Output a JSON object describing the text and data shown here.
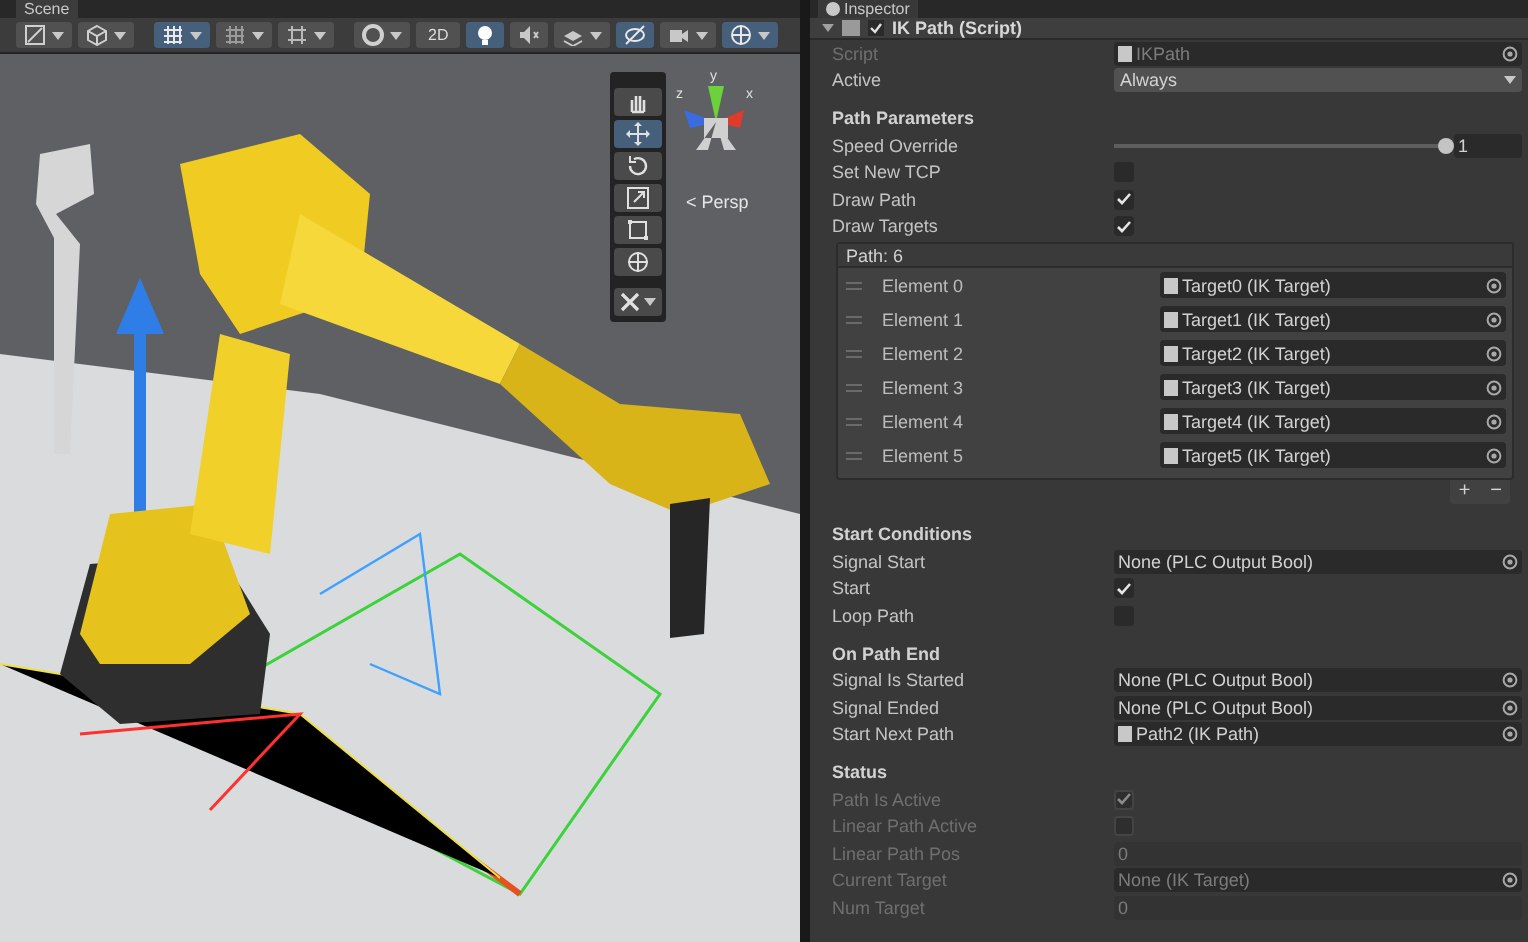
{
  "scene": {
    "tab": "Scene",
    "toolbar": [
      [
        {
          "selected": false,
          "dropdown": true
        },
        {
          "selected": false,
          "dropdown": true
        }
      ],
      [
        {
          "selected": true,
          "dropdown": true
        },
        {
          "selected": false,
          "dropdown": true
        },
        {
          "selected": false,
          "dropdown": true
        }
      ],
      [
        {
          "selected": false,
          "dropdown": true
        },
        {
          "selected": false,
          "dropdown": false,
          "label": "2D"
        },
        {
          "selected": true,
          "dropdown": false
        },
        {
          "selected": false,
          "dropdown": false
        },
        {
          "selected": false,
          "dropdown": true
        },
        {
          "selected": true,
          "dropdown": false
        },
        {
          "selected": false,
          "dropdown": true
        },
        {
          "selected": true,
          "dropdown": true
        }
      ]
    ],
    "tools": [
      {
        "selected": false
      },
      {
        "selected": true
      },
      {
        "selected": false
      },
      {
        "selected": false
      },
      {
        "selected": false
      },
      {
        "selected": false
      }
    ],
    "axes": [
      "y",
      "x",
      "z"
    ],
    "view_label": "< Persp"
  },
  "inspector": {
    "tab": "Inspector",
    "component": {
      "title": "IK Path (Script)",
      "enabled": true
    },
    "groups": [
      {
        "fields": [
          {
            "kind": "object",
            "label": "Script",
            "value": "IKPath",
            "icon": true,
            "disabled": true
          },
          {
            "kind": "dropdown",
            "label": "Active",
            "value": "Always",
            "disabled": false
          }
        ]
      },
      {
        "title": "Path Parameters",
        "fields": [
          {
            "kind": "slider",
            "label": "Speed Override",
            "level": 1,
            "value": "1",
            "disabled": false
          },
          {
            "kind": "checkbox",
            "label": "Set New TCP",
            "checked": false,
            "disabled": false
          },
          {
            "kind": "checkbox",
            "label": "Draw Path",
            "checked": true,
            "disabled": false
          },
          {
            "kind": "checkbox",
            "label": "Draw Targets",
            "checked": true,
            "disabled": false
          }
        ],
        "list": {
          "header": "Path: 6",
          "add": "+",
          "remove": "−",
          "elements": [
            {
              "label": "Element 0",
              "value": "Target0 (IK Target)"
            },
            {
              "label": "Element 1",
              "value": "Target1 (IK Target)"
            },
            {
              "label": "Element 2",
              "value": "Target2 (IK Target)"
            },
            {
              "label": "Element 3",
              "value": "Target3 (IK Target)"
            },
            {
              "label": "Element 4",
              "value": "Target4 (IK Target)"
            },
            {
              "label": "Element 5",
              "value": "Target5 (IK Target)"
            }
          ]
        }
      },
      {
        "title": "Start Conditions",
        "fields": [
          {
            "kind": "object",
            "label": "Signal Start",
            "value": "None (PLC Output Bool)",
            "icon": false,
            "disabled": false
          },
          {
            "kind": "checkbox",
            "label": "Start",
            "checked": true,
            "disabled": false
          },
          {
            "kind": "checkbox",
            "label": "Loop Path",
            "checked": false,
            "disabled": false
          }
        ]
      },
      {
        "title": "On Path End",
        "fields": [
          {
            "kind": "object",
            "label": "Signal Is Started",
            "value": "None (PLC Output Bool)",
            "icon": false,
            "disabled": false
          },
          {
            "kind": "object",
            "label": "Signal Ended",
            "value": "None (PLC Output Bool)",
            "icon": false,
            "disabled": false
          },
          {
            "kind": "object",
            "label": "Start Next Path",
            "value": "Path2 (IK Path)",
            "icon": true,
            "disabled": false
          }
        ]
      },
      {
        "title": "Status",
        "fields": [
          {
            "kind": "checkbox",
            "label": "Path Is Active",
            "checked": true,
            "disabled": true
          },
          {
            "kind": "checkbox",
            "label": "Linear Path Active",
            "checked": false,
            "disabled": true
          },
          {
            "kind": "number",
            "label": "Linear Path Pos",
            "value": "0",
            "disabled": true
          },
          {
            "kind": "object",
            "label": "Current Target",
            "value": "None (IK Target)",
            "icon": false,
            "disabled": true
          },
          {
            "kind": "number",
            "label": "Num Target",
            "value": "0",
            "disabled": true
          }
        ]
      }
    ]
  }
}
